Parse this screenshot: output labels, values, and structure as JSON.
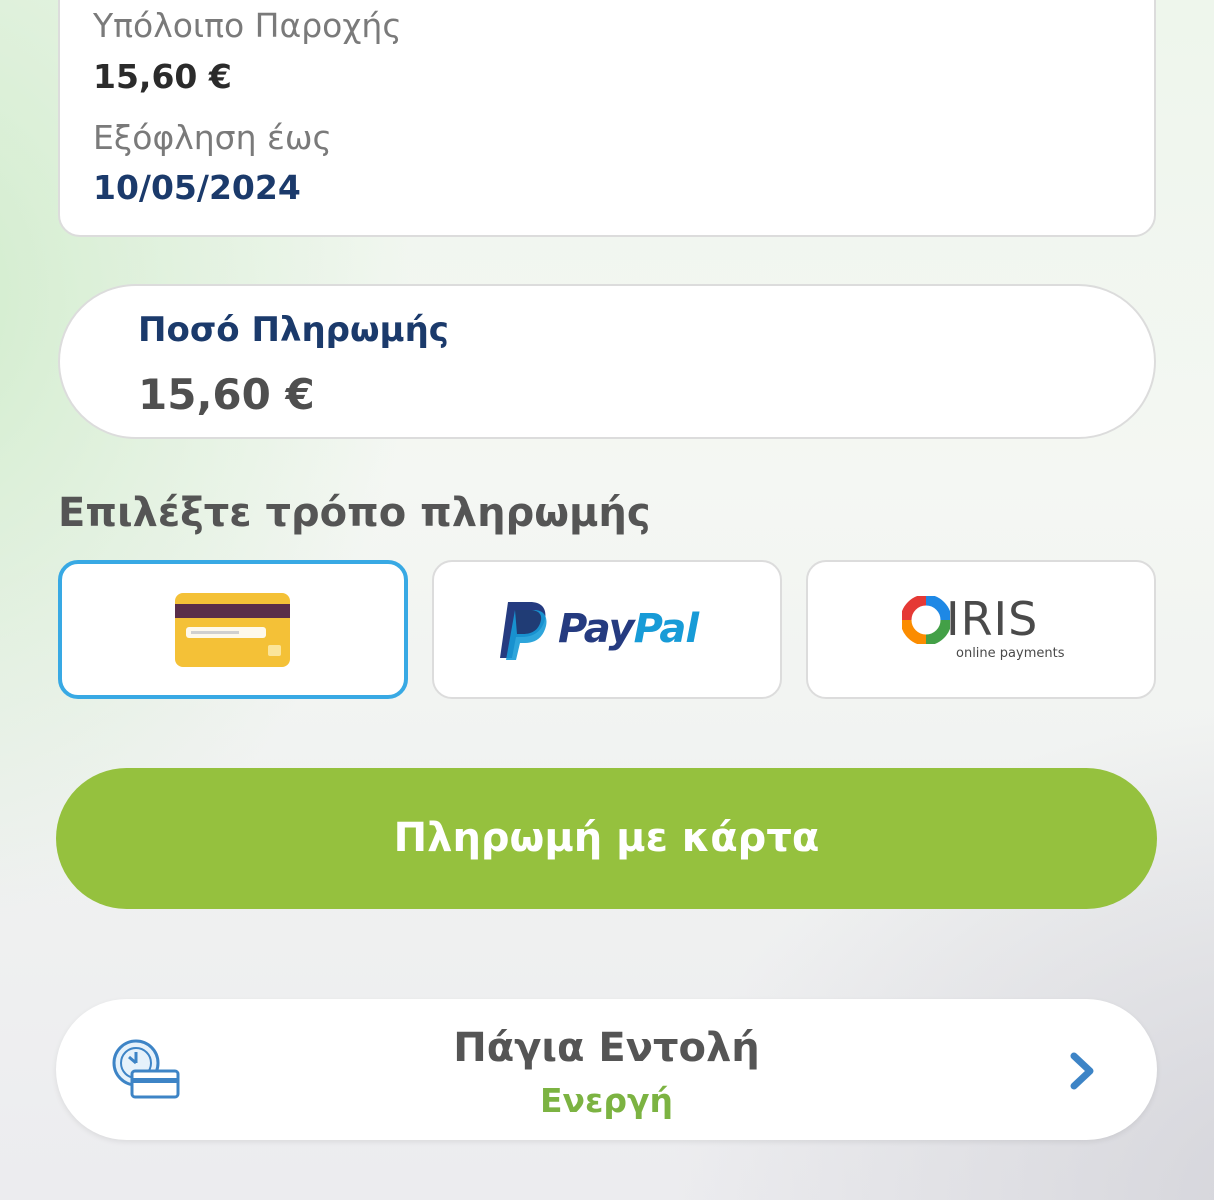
{
  "summary": {
    "balance_label": "Υπόλοιπο Παροχής",
    "balance_value": "15,60 €",
    "due_label": "Εξόφληση έως",
    "due_value": "10/05/2024"
  },
  "payment_amount": {
    "label": "Ποσό Πληρωμής",
    "value": "15,60 €"
  },
  "payment_methods": {
    "title": "Επιλέξτε τρόπο πληρωμής",
    "options": [
      {
        "id": "card",
        "icon": "credit-card-icon",
        "selected": true
      },
      {
        "id": "paypal",
        "icon": "paypal-logo",
        "logo_text_a": "Pay",
        "logo_text_b": "Pal",
        "selected": false
      },
      {
        "id": "iris",
        "icon": "iris-logo",
        "logo_text": "IRIS",
        "logo_subtext": "online payments",
        "selected": false
      }
    ]
  },
  "primary_action": {
    "label": "Πληρωμή με κάρτα"
  },
  "standing_order": {
    "title": "Πάγια Εντολή",
    "status": "Ενεργή"
  },
  "colors": {
    "accent_green": "#95c13e",
    "status_green": "#7cb342",
    "selected_border": "#38a9e4",
    "navy_text": "#1b3a6b",
    "paypal_dark": "#253b80",
    "paypal_light": "#179bd7",
    "chevron_blue": "#3d84c6"
  }
}
